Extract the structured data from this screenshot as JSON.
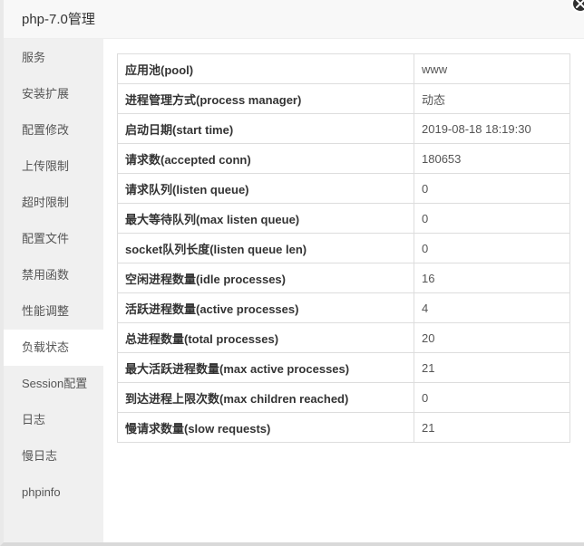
{
  "window": {
    "title": "php-7.0管理"
  },
  "sidebar": {
    "active_index": 8,
    "items": [
      {
        "label": "服务"
      },
      {
        "label": "安装扩展"
      },
      {
        "label": "配置修改"
      },
      {
        "label": "上传限制"
      },
      {
        "label": "超时限制"
      },
      {
        "label": "配置文件"
      },
      {
        "label": "禁用函数"
      },
      {
        "label": "性能调整"
      },
      {
        "label": "负载状态"
      },
      {
        "label": "Session配置"
      },
      {
        "label": "日志"
      },
      {
        "label": "慢日志"
      },
      {
        "label": "phpinfo"
      }
    ]
  },
  "status_table": {
    "rows": [
      {
        "key": "应用池(pool)",
        "value": "www"
      },
      {
        "key": "进程管理方式(process manager)",
        "value": "动态"
      },
      {
        "key": "启动日期(start time)",
        "value": "2019-08-18 18:19:30"
      },
      {
        "key": "请求数(accepted conn)",
        "value": "180653"
      },
      {
        "key": "请求队列(listen queue)",
        "value": "0"
      },
      {
        "key": "最大等待队列(max listen queue)",
        "value": "0"
      },
      {
        "key": "socket队列长度(listen queue len)",
        "value": "0"
      },
      {
        "key": "空闲进程数量(idle processes)",
        "value": "16"
      },
      {
        "key": "活跃进程数量(active processes)",
        "value": "4"
      },
      {
        "key": "总进程数量(total processes)",
        "value": "20"
      },
      {
        "key": "最大活跃进程数量(max active processes)",
        "value": "21"
      },
      {
        "key": "到达进程上限次数(max children reached)",
        "value": "0"
      },
      {
        "key": "慢请求数量(slow requests)",
        "value": "21"
      }
    ]
  },
  "icons": {
    "close": "close-icon"
  }
}
